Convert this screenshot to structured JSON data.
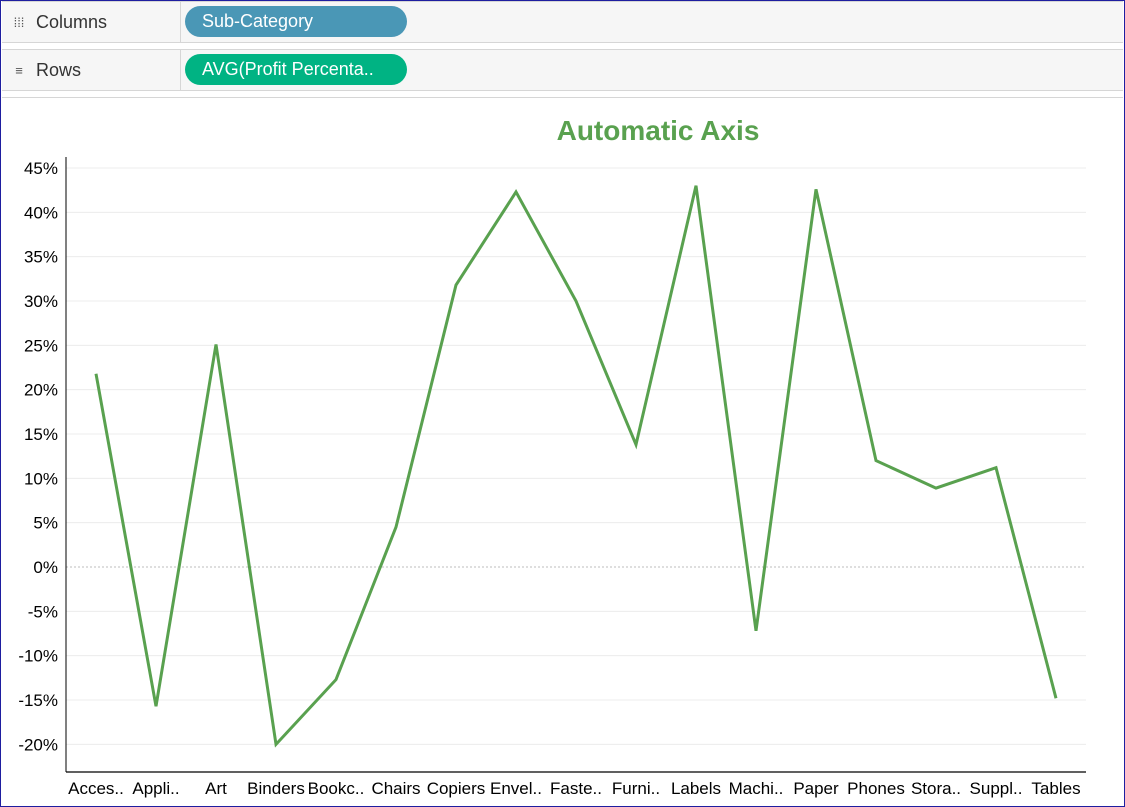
{
  "shelves": {
    "columns": {
      "icon": "columns-icon",
      "label": "Columns",
      "pill": "Sub-Category",
      "pill_color": "#4a97b6"
    },
    "rows": {
      "icon": "rows-icon",
      "label": "Rows",
      "pill": "AVG(Profit Percenta..",
      "pill_color": "#00b383"
    }
  },
  "chart_data": {
    "type": "line",
    "title": "Automatic Axis",
    "title_color": "#59a14f",
    "line_color": "#59a14f",
    "categories": [
      "Acces..",
      "Appli..",
      "Art",
      "Binders",
      "Bookc..",
      "Chairs",
      "Copiers",
      "Envel..",
      "Faste..",
      "Furni..",
      "Labels",
      "Machi..",
      "Paper",
      "Phones",
      "Stora..",
      "Suppl..",
      "Tables"
    ],
    "series": [
      {
        "values": [
          21.8,
          -15.7,
          25.1,
          -20.0,
          -12.7,
          4.5,
          31.8,
          42.3,
          30.0,
          13.8,
          43.0,
          -7.2,
          42.6,
          12.0,
          8.9,
          11.2,
          -14.8
        ]
      }
    ],
    "yticks": [
      "45%",
      "40%",
      "35%",
      "30%",
      "25%",
      "20%",
      "15%",
      "10%",
      "5%",
      "0%",
      "-5%",
      "-10%",
      "-15%",
      "-20%"
    ],
    "ytick_values": [
      45,
      40,
      35,
      30,
      25,
      20,
      15,
      10,
      5,
      0,
      -5,
      -10,
      -15,
      -20
    ],
    "ylim": [
      -23,
      46.5
    ],
    "grid": true,
    "xlabel": "",
    "ylabel": ""
  }
}
